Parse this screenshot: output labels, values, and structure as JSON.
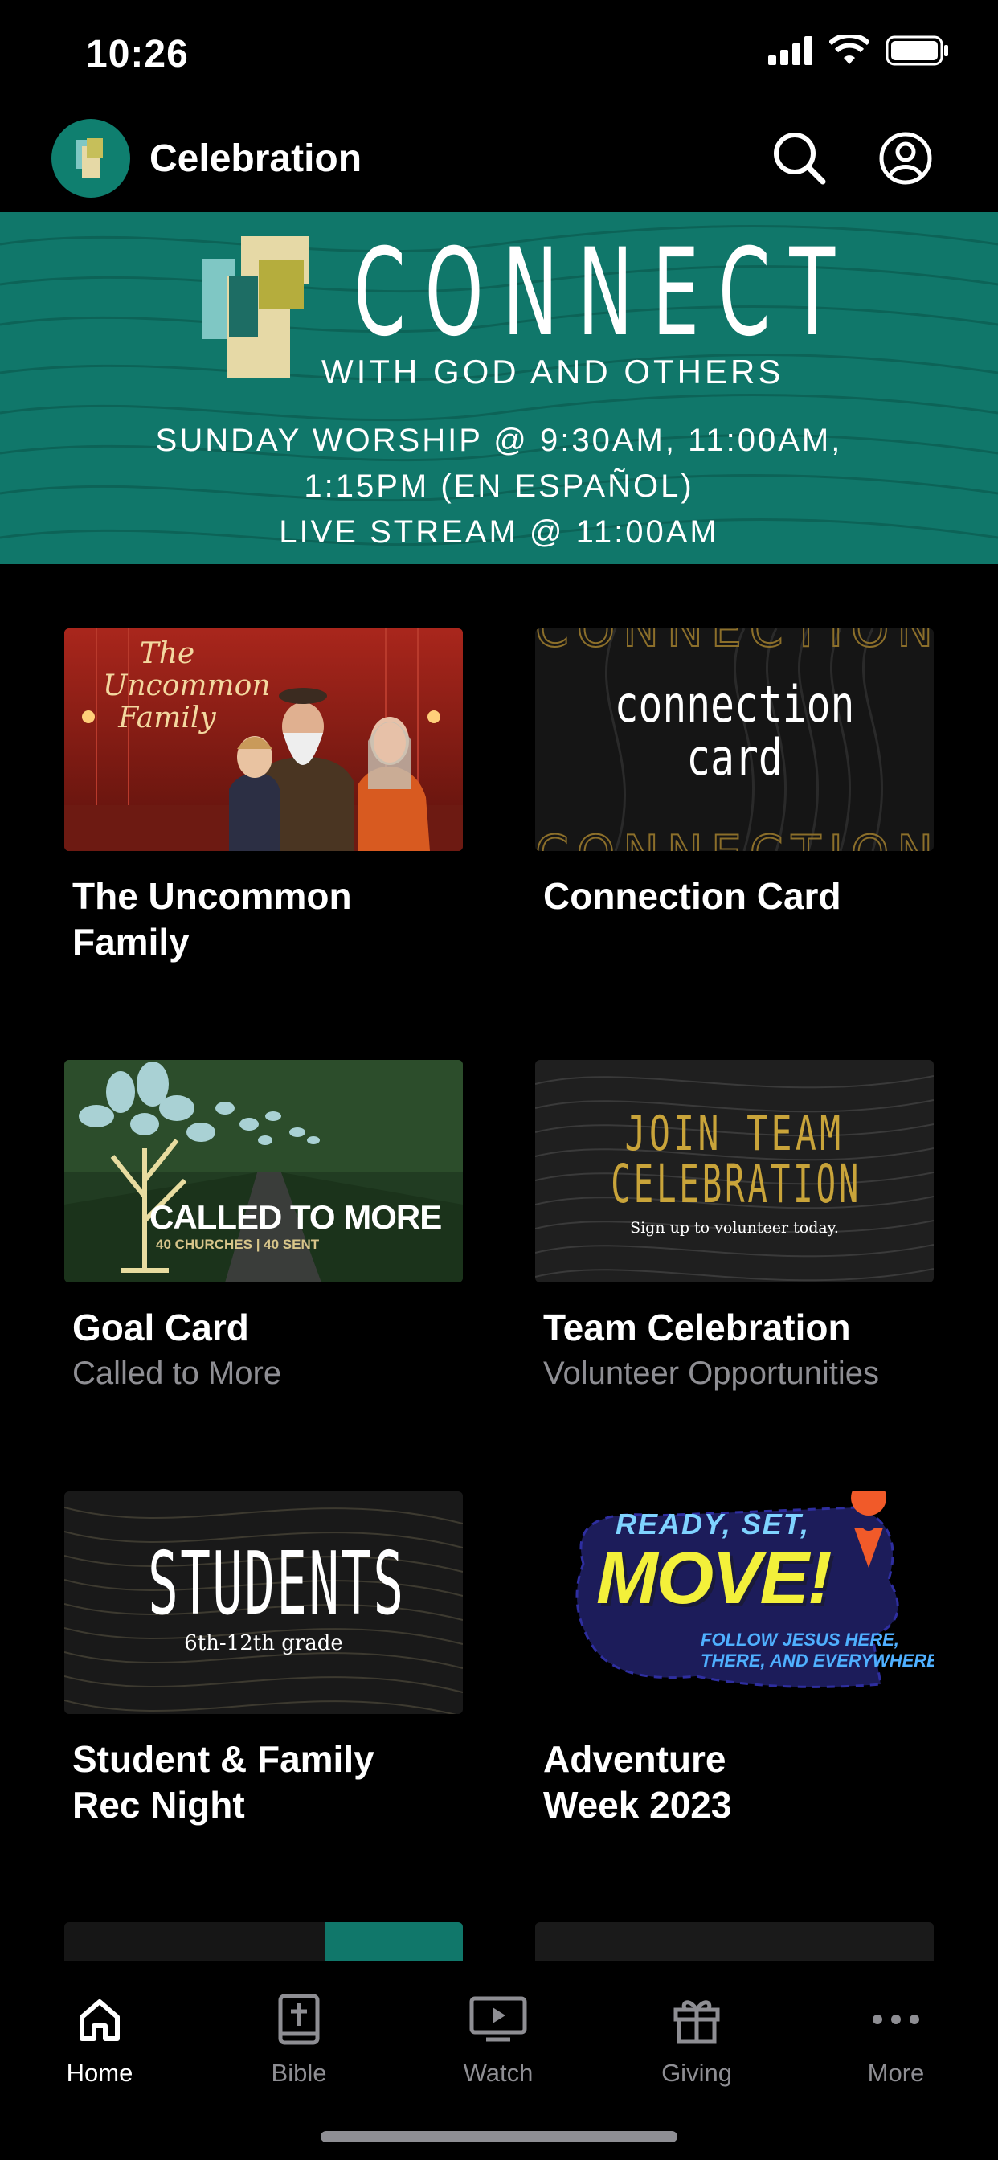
{
  "status_bar": {
    "time": "10:26"
  },
  "header": {
    "title": "Celebration"
  },
  "banner": {
    "title": "CONNECT",
    "subtitle": "WITH GOD AND OTHERS",
    "line1": "SUNDAY WORSHIP @ 9:30AM, 11:00AM,",
    "line2": "1:15PM (EN ESPAÑOL)",
    "line3": "LIVE STREAM @ 11:00AM"
  },
  "cards": [
    {
      "title": "The Uncommon\nFamily",
      "subtitle": "",
      "thumb_text": "The Uncommon Family"
    },
    {
      "title": "Connection Card",
      "subtitle": "",
      "thumb_text": "connection card"
    },
    {
      "title": "Goal Card",
      "subtitle": "Called to More",
      "thumb_text": "CALLED TO MORE",
      "thumb_sub": "40 CHURCHES | 40 SENT"
    },
    {
      "title": "Team Celebration",
      "subtitle": "Volunteer Opportunities",
      "thumb_text1": "JOIN TEAM",
      "thumb_text2": "CELEBRATION",
      "thumb_sub": "Sign up to volunteer today."
    },
    {
      "title": "Student & Family\nRec Night",
      "subtitle": "",
      "thumb_text": "STUDENTS",
      "thumb_sub": "6th-12th grade"
    },
    {
      "title": "Adventure\nWeek 2023",
      "subtitle": "",
      "thumb_text1": "READY, SET,",
      "thumb_text2": "MOVE!",
      "thumb_sub1": "FOLLOW JESUS HERE,",
      "thumb_sub2": "THERE, AND EVERYWHERE"
    }
  ],
  "tabs": [
    {
      "label": "Home",
      "icon": "home-icon",
      "active": true
    },
    {
      "label": "Bible",
      "icon": "bible-icon",
      "active": false
    },
    {
      "label": "Watch",
      "icon": "tv-icon",
      "active": false
    },
    {
      "label": "Giving",
      "icon": "gift-icon",
      "active": false
    },
    {
      "label": "More",
      "icon": "more-icon",
      "active": false
    }
  ],
  "colors": {
    "banner": "#10776a",
    "gold": "#c9a43a",
    "inactive": "#8e8e93"
  }
}
